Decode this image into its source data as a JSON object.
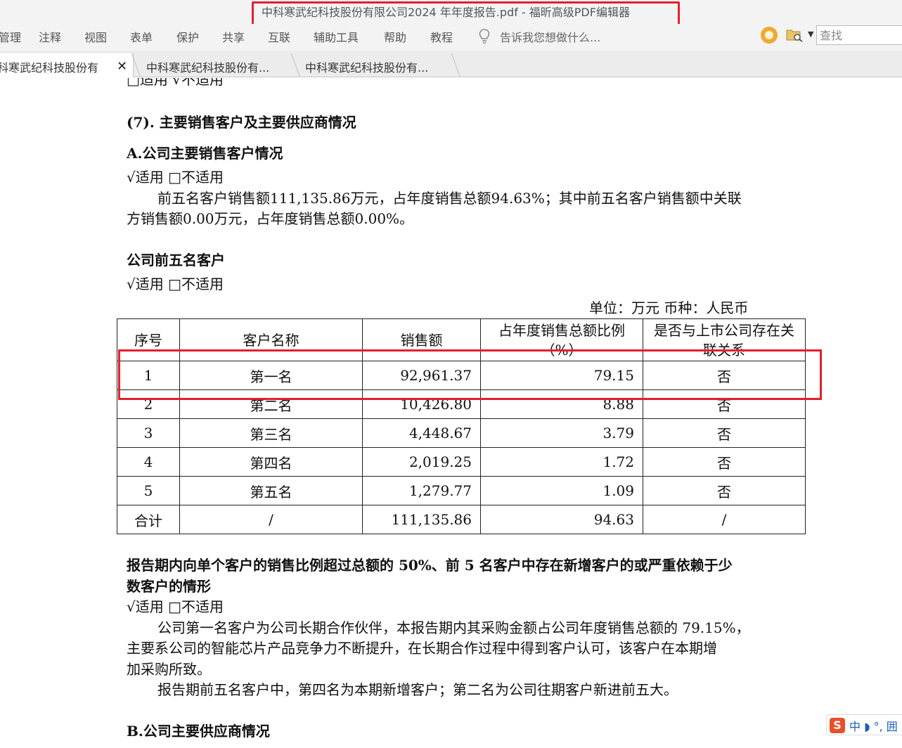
{
  "window": {
    "title": "中科寒武纪科技股份有限公司2024 年年度报告.pdf - 福昕高级PDF编辑器"
  },
  "menu": {
    "items": [
      "管理",
      "注释",
      "视图",
      "表单",
      "保护",
      "共享",
      "互联",
      "辅助工具",
      "帮助",
      "教程"
    ],
    "tell_me": "告诉我您想做什么...",
    "search_placeholder": "查找"
  },
  "tabs": [
    {
      "label": "中科寒武纪科技股份有..."
    },
    {
      "label": "中科寒武纪科技股份有..."
    },
    {
      "label": "中科寒武纪科技股份有..."
    }
  ],
  "document": {
    "clipped_top": "□适用 √不适用",
    "section_heading": "(7).  主要销售客户及主要供应商情况",
    "sub_a": "A.公司主要销售客户情况",
    "applicable_1": "√适用 □不适用",
    "summary_line1": "前五名客户销售额111,135.86万元，占年度销售总额94.63%；其中前五名客户销售额中关联",
    "summary_line2": "方销售额0.00万元，占年度销售总额0.00%。",
    "top5_heading": "公司前五名客户",
    "applicable_2": "√适用 □不适用",
    "unit_line": "单位：万元    币种：人民币",
    "table": {
      "headers": [
        "序号",
        "客户名称",
        "销售额",
        "占年度销售总额比例（%）",
        "是否与上市公司存在关联关系"
      ],
      "rows": [
        [
          "1",
          "第一名",
          "92,961.37",
          "79.15",
          "否"
        ],
        [
          "2",
          "第二名",
          "10,426.80",
          "8.88",
          "否"
        ],
        [
          "3",
          "第三名",
          "4,448.67",
          "3.79",
          "否"
        ],
        [
          "4",
          "第四名",
          "2,019.25",
          "1.72",
          "否"
        ],
        [
          "5",
          "第五名",
          "1,279.77",
          "1.09",
          "否"
        ],
        [
          "合计",
          "/",
          "111,135.86",
          "94.63",
          "/"
        ]
      ]
    },
    "concentration_heading_1": "报告期内向单个客户的销售比例超过总额的 50%、前 5 名客户中存在新增客户的或严重依赖于少",
    "concentration_heading_2": "数客户的情形",
    "applicable_3": "√适用 □不适用",
    "explain_line1": "公司第一名客户为公司长期合作伙伴，本报告期内其采购金额占公司年度销售总额的 79.15%，",
    "explain_line2": "主要系公司的智能芯片产品竞争力不断提升，在长期合作过程中得到客户认可，该客户在本期增",
    "explain_line3": "加采购所致。",
    "explain_line4": "报告期前五名客户中，第四名为本期新增客户；第二名为公司往期客户新进前五大。",
    "sub_b": "B.公司主要供应商情况"
  },
  "ime": {
    "logo": "S",
    "text": "中 ◗ °, 囲"
  }
}
